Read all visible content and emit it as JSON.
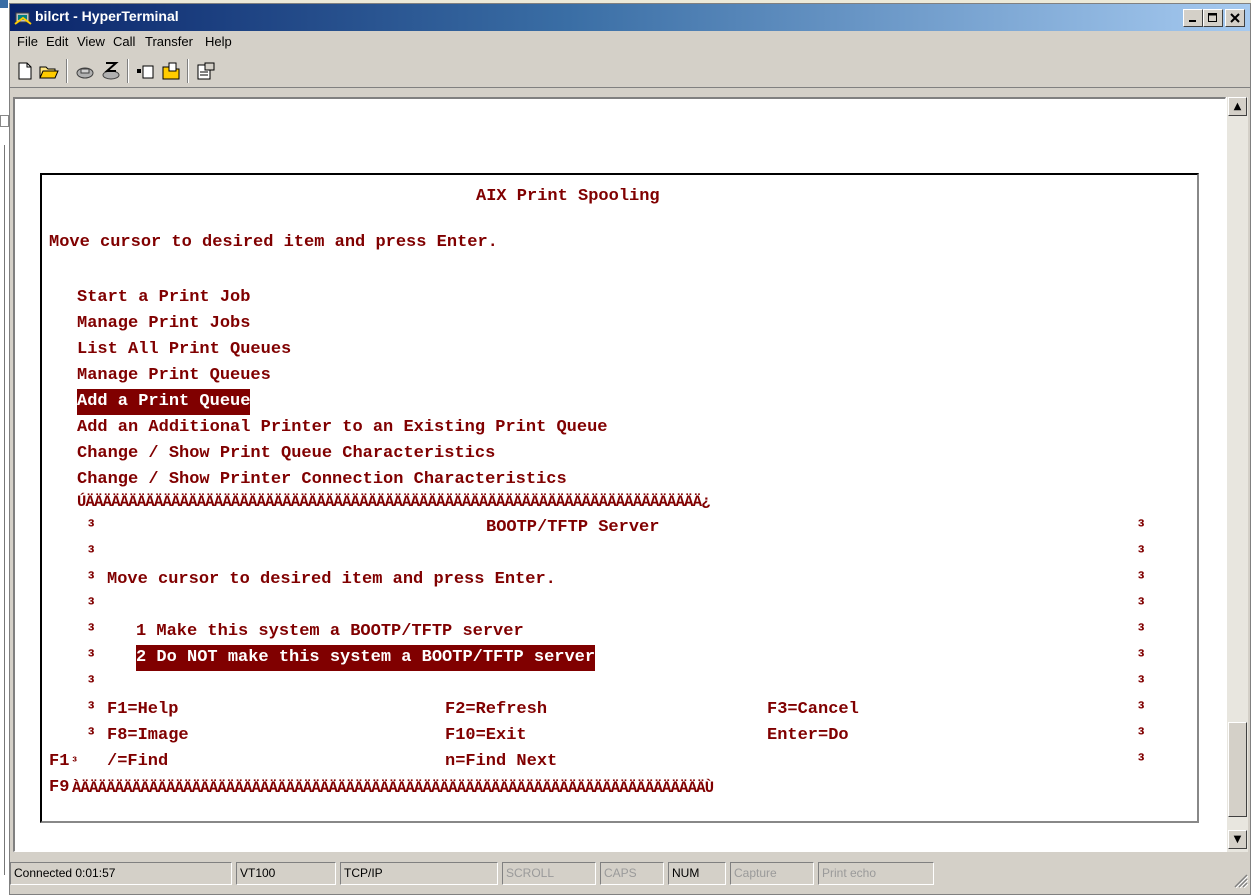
{
  "window": {
    "title": "bilcrt - HyperTerminal"
  },
  "menu": [
    "File",
    "Edit",
    "View",
    "Call",
    "Transfer",
    "Help"
  ],
  "toolbar": {
    "icons": [
      "new-file-icon",
      "open-folder-icon",
      "disconnect-icon",
      "dial-icon",
      "send-icon",
      "receive-icon",
      "properties-icon"
    ]
  },
  "terminal": {
    "title": "AIX Print Spooling",
    "instruction": "Move cursor to desired item and press Enter.",
    "menu_items": [
      "Start a Print Job",
      "Manage Print Jobs",
      "List All Print Queues",
      "Manage Print Queues",
      "Add a Print Queue",
      "Add an Additional Printer to an Existing Print Queue",
      "Change / Show Print Queue Characteristics",
      "Change / Show Printer Connection Characteristics"
    ],
    "selected_menu_item": "Add a Print Queue",
    "popup": {
      "top_border": "ÚÄÄÄÄÄÄÄÄÄÄÄÄÄÄÄÄÄÄÄÄÄÄÄÄÄÄÄÄÄÄÄÄÄÄÄÄÄÄÄÄÄÄÄÄÄÄÄÄÄÄÄÄÄÄÄÄÄÄÄÄÄÄÄÄÄÄÄÄÄÄÄÄ¿",
      "side": "³",
      "title": "BOOTP/TFTP Server",
      "instruction": "Move cursor to desired item and press Enter.",
      "option1": "1 Make this system a BOOTP/TFTP server",
      "option2": "2 Do NOT make this system a BOOTP/TFTP server",
      "keys": {
        "f1": "F1=Help",
        "f2": "F2=Refresh",
        "f3": "F3=Cancel",
        "f8": "F8=Image",
        "f10": "F10=Exit",
        "enter": "Enter=Do",
        "find": "/=Find",
        "find_next": "n=Find Next"
      },
      "left_prefix_a": "F1",
      "left_prefix_b": "F9",
      "bottom_border": "ÀÄÄÄÄÄÄÄÄÄÄÄÄÄÄÄÄÄÄÄÄÄÄÄÄÄÄÄÄÄÄÄÄÄÄÄÄÄÄÄÄÄÄÄÄÄÄÄÄÄÄÄÄÄÄÄÄÄÄÄÄÄÄÄÄÄÄÄÄÄÄÄÄÄÙ"
    }
  },
  "status": {
    "connected": "Connected 0:01:57",
    "emulation": "VT100",
    "protocol": "TCP/IP",
    "scroll": "SCROLL",
    "caps": "CAPS",
    "num": "NUM",
    "capture": "Capture",
    "print_echo": "Print echo"
  },
  "colors": {
    "terminal_text": "#800000",
    "highlight_bg": "#800000",
    "title_start": "#0a246a",
    "title_end": "#a6caf0"
  }
}
